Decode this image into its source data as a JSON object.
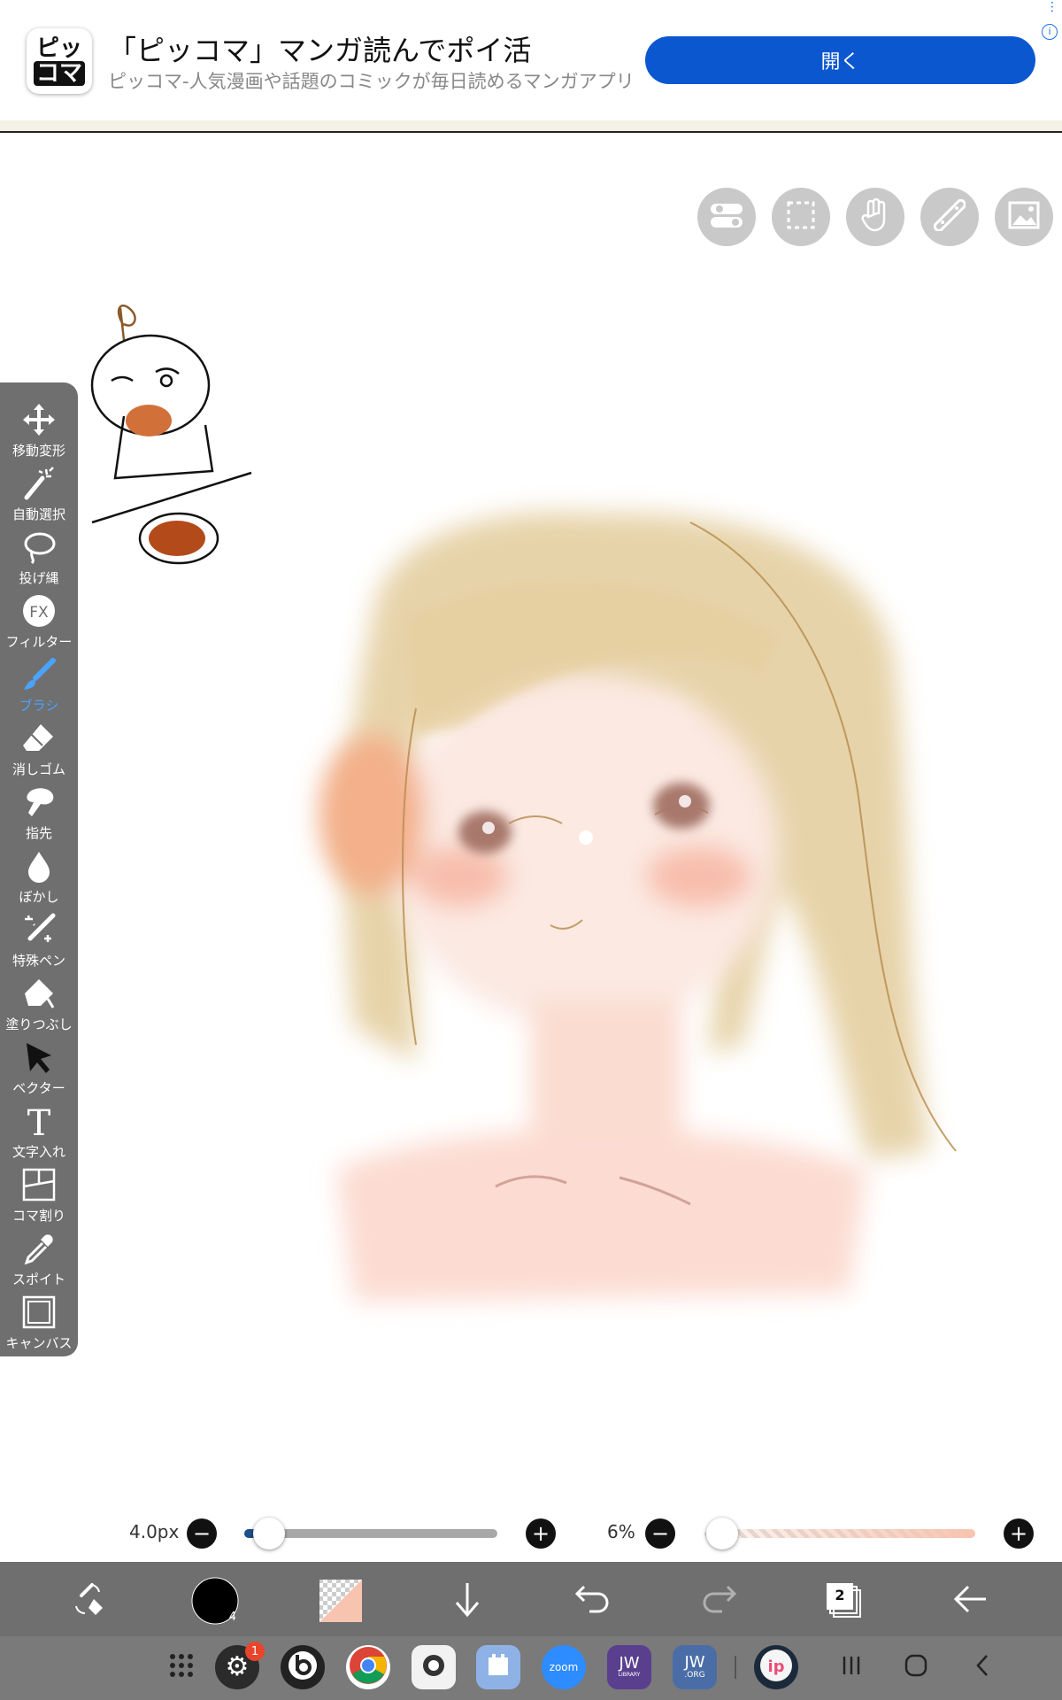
{
  "ad": {
    "icon_line1": "ピッ",
    "icon_line2": "コマ",
    "title": "「ピッコマ」マンガ読んでポイ活",
    "subtitle": "ピッコマ-人気漫画や話題のコミックが毎日読めるマンガアプリ",
    "open_button": "開く"
  },
  "top_tools": [
    "toggle-icon",
    "selection-icon",
    "hand-icon",
    "ruler-icon",
    "image-icon"
  ],
  "left_tools": [
    {
      "label": "移動変形",
      "icon": "move-icon",
      "active": false
    },
    {
      "label": "自動選択",
      "icon": "magic-wand-icon",
      "active": false
    },
    {
      "label": "投げ縄",
      "icon": "lasso-icon",
      "active": false
    },
    {
      "label": "フィルター",
      "icon": "fx-icon",
      "active": false
    },
    {
      "label": "ブラシ",
      "icon": "brush-icon",
      "active": true
    },
    {
      "label": "消しゴム",
      "icon": "eraser-icon",
      "active": false
    },
    {
      "label": "指先",
      "icon": "finger-icon",
      "active": false
    },
    {
      "label": "ぼかし",
      "icon": "blur-icon",
      "active": false
    },
    {
      "label": "特殊ペン",
      "icon": "special-pen-icon",
      "active": false
    },
    {
      "label": "塗りつぶし",
      "icon": "fill-icon",
      "active": false
    },
    {
      "label": "ベクター",
      "icon": "vector-icon",
      "active": false
    },
    {
      "label": "文字入れ",
      "icon": "text-icon",
      "active": false
    },
    {
      "label": "コマ割り",
      "icon": "panel-icon",
      "active": false
    },
    {
      "label": "スポイト",
      "icon": "eyedropper-icon",
      "active": false
    },
    {
      "label": "キャンバス",
      "icon": "canvas-icon",
      "active": false
    }
  ],
  "brush": {
    "size_label": "4.0px",
    "size_value": 0.05,
    "opacity_label": "6%",
    "opacity_value": 0.06,
    "minus": "−",
    "plus": "+"
  },
  "bottom_bar": {
    "color_badge": "4",
    "layer_count": "2"
  },
  "taskbar": {
    "settings_badge": "1",
    "apps": [
      "apps-grid-icon",
      "settings-icon",
      "beats-icon",
      "chrome-icon",
      "camera-icon",
      "app-icon",
      "zoom-icon",
      "jw-library-icon",
      "jw-org-icon",
      "ibispaint-icon"
    ],
    "zoom_label": "zoom",
    "jw_label": "JW",
    "jw_library_sub": "LIBRARY",
    "jw_org_sub": ".ORG"
  },
  "colors": {
    "toolbar_bg": "#6f6f6f",
    "active_tool": "#4aa3ff",
    "ad_button": "#0b57d0",
    "current_color": "#000000",
    "secondary_color": "#f7c4b0"
  }
}
